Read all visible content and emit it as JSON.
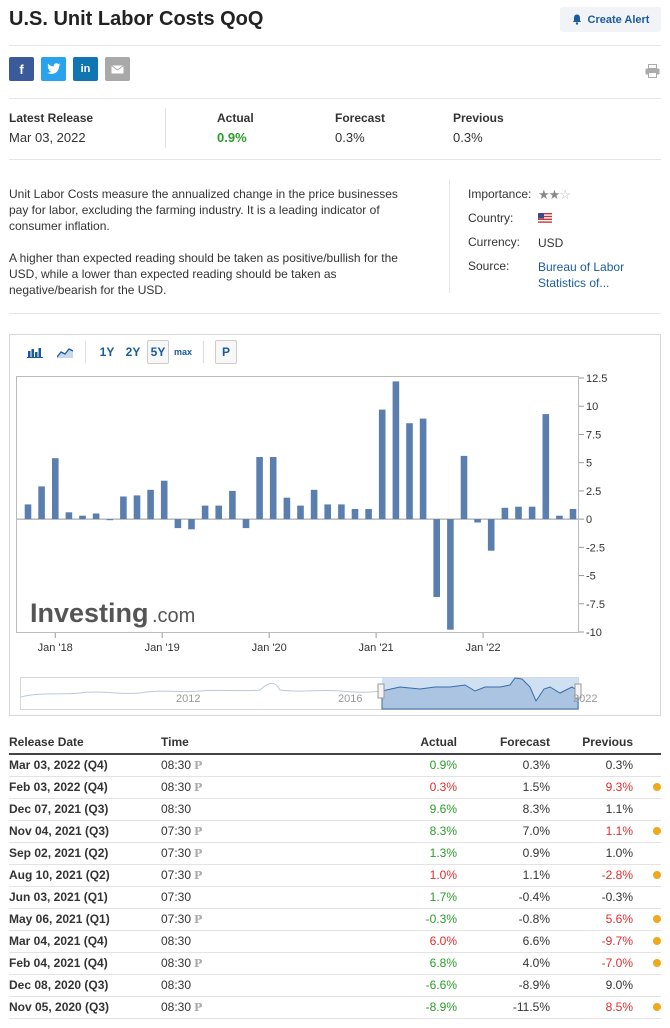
{
  "title": "U.S. Unit Labor Costs QoQ",
  "alert_button": "Create Alert",
  "icons": {
    "facebook": "f",
    "twitter": "twitter-bird-icon",
    "linkedin": "in",
    "mail": "mail-icon",
    "print": "printer-icon",
    "bell": "bell-icon"
  },
  "release": {
    "latest_label": "Latest Release",
    "latest_date": "Mar 03, 2022",
    "actual_label": "Actual",
    "actual_value": "0.9%",
    "forecast_label": "Forecast",
    "forecast_value": "0.3%",
    "previous_label": "Previous",
    "previous_value": "0.3%"
  },
  "description": [
    "Unit Labor Costs measure the annualized change in the price businesses pay for labor, excluding the farming industry. It is a leading indicator of consumer inflation.",
    "A higher than expected reading should be taken as positive/bullish for the USD, while a lower than expected reading should be taken as negative/bearish for the USD."
  ],
  "info": {
    "importance_label": "Importance:",
    "importance_stars": 2,
    "importance_max": 3,
    "country_label": "Country:",
    "currency_label": "Currency:",
    "currency_value": "USD",
    "source_label": "Source:",
    "source_value": "Bureau of Labor Statistics of..."
  },
  "chart_tools": {
    "range_1y": "1Y",
    "range_2y": "2Y",
    "range_5y": "5Y",
    "range_max": "max",
    "p_button": "P"
  },
  "chart_data": {
    "type": "bar",
    "watermark": "Investing",
    "watermark_suffix": ".com",
    "ylim": [
      -10,
      12.5
    ],
    "y_ticks": [
      12.5,
      10,
      7.5,
      5,
      2.5,
      0,
      -2.5,
      -5,
      -7.5,
      -10
    ],
    "y_tick_labels": [
      "12.5",
      "10",
      "7.5",
      "5",
      "2.5",
      "0",
      "-2.5",
      "-5",
      "-7.5",
      "-10"
    ],
    "x_tick_labels": [
      "Jan '18",
      "Jan '19",
      "Jan '20",
      "Jan '21",
      "Jan '22"
    ],
    "values": [
      1.3,
      2.9,
      5.4,
      0.6,
      0.3,
      0.5,
      -0.1,
      2.0,
      2.1,
      2.6,
      3.4,
      -0.8,
      -0.9,
      1.2,
      1.2,
      2.5,
      -0.8,
      5.5,
      5.5,
      1.9,
      1.2,
      2.6,
      1.3,
      1.3,
      0.9,
      0.9,
      9.7,
      12.2,
      8.5,
      8.9,
      -6.9,
      -9.8,
      5.6,
      -0.3,
      -2.8,
      1.0,
      1.1,
      1.1,
      9.3,
      0.3,
      0.9
    ],
    "color": "#5a7fae",
    "navigator_labels": [
      "2012",
      "2016",
      "2022"
    ]
  },
  "table": {
    "headers": [
      "Release Date",
      "Time",
      "Actual",
      "Forecast",
      "Previous"
    ],
    "rows": [
      {
        "date": "Mar 03, 2022 (Q4)",
        "time": "08:30",
        "p": "P",
        "actual": "0.9%",
        "ac": "green",
        "forecast": "0.3%",
        "previous": "0.3%",
        "pc": "",
        "dot": false
      },
      {
        "date": "Feb 03, 2022 (Q4)",
        "time": "08:30",
        "p": "P",
        "actual": "0.3%",
        "ac": "red",
        "forecast": "1.5%",
        "previous": "9.3%",
        "pc": "red",
        "dot": true
      },
      {
        "date": "Dec 07, 2021 (Q3)",
        "time": "08:30",
        "p": "",
        "actual": "9.6%",
        "ac": "green",
        "forecast": "8.3%",
        "previous": "1.1%",
        "pc": "",
        "dot": false
      },
      {
        "date": "Nov 04, 2021 (Q3)",
        "time": "07:30",
        "p": "P",
        "actual": "8.3%",
        "ac": "green",
        "forecast": "7.0%",
        "previous": "1.1%",
        "pc": "red",
        "dot": true
      },
      {
        "date": "Sep 02, 2021 (Q2)",
        "time": "07:30",
        "p": "P",
        "actual": "1.3%",
        "ac": "green",
        "forecast": "0.9%",
        "previous": "1.0%",
        "pc": "",
        "dot": false
      },
      {
        "date": "Aug 10, 2021 (Q2)",
        "time": "07:30",
        "p": "P",
        "actual": "1.0%",
        "ac": "red",
        "forecast": "1.1%",
        "previous": "-2.8%",
        "pc": "red",
        "dot": true
      },
      {
        "date": "Jun 03, 2021 (Q1)",
        "time": "07:30",
        "p": "",
        "actual": "1.7%",
        "ac": "green",
        "forecast": "-0.4%",
        "previous": "-0.3%",
        "pc": "",
        "dot": false
      },
      {
        "date": "May 06, 2021 (Q1)",
        "time": "07:30",
        "p": "P",
        "actual": "-0.3%",
        "ac": "green",
        "forecast": "-0.8%",
        "previous": "5.6%",
        "pc": "red",
        "dot": true
      },
      {
        "date": "Mar 04, 2021 (Q4)",
        "time": "08:30",
        "p": "",
        "actual": "6.0%",
        "ac": "red",
        "forecast": "6.6%",
        "previous": "-9.7%",
        "pc": "red",
        "dot": true
      },
      {
        "date": "Feb 04, 2021 (Q4)",
        "time": "08:30",
        "p": "P",
        "actual": "6.8%",
        "ac": "green",
        "forecast": "4.0%",
        "previous": "-7.0%",
        "pc": "red",
        "dot": true
      },
      {
        "date": "Dec 08, 2020 (Q3)",
        "time": "08:30",
        "p": "",
        "actual": "-6.6%",
        "ac": "green",
        "forecast": "-8.9%",
        "previous": "9.0%",
        "pc": "",
        "dot": false
      },
      {
        "date": "Nov 05, 2020 (Q3)",
        "time": "08:30",
        "p": "P",
        "actual": "-8.9%",
        "ac": "green",
        "forecast": "-11.5%",
        "previous": "8.5%",
        "pc": "red",
        "dot": true
      }
    ]
  }
}
